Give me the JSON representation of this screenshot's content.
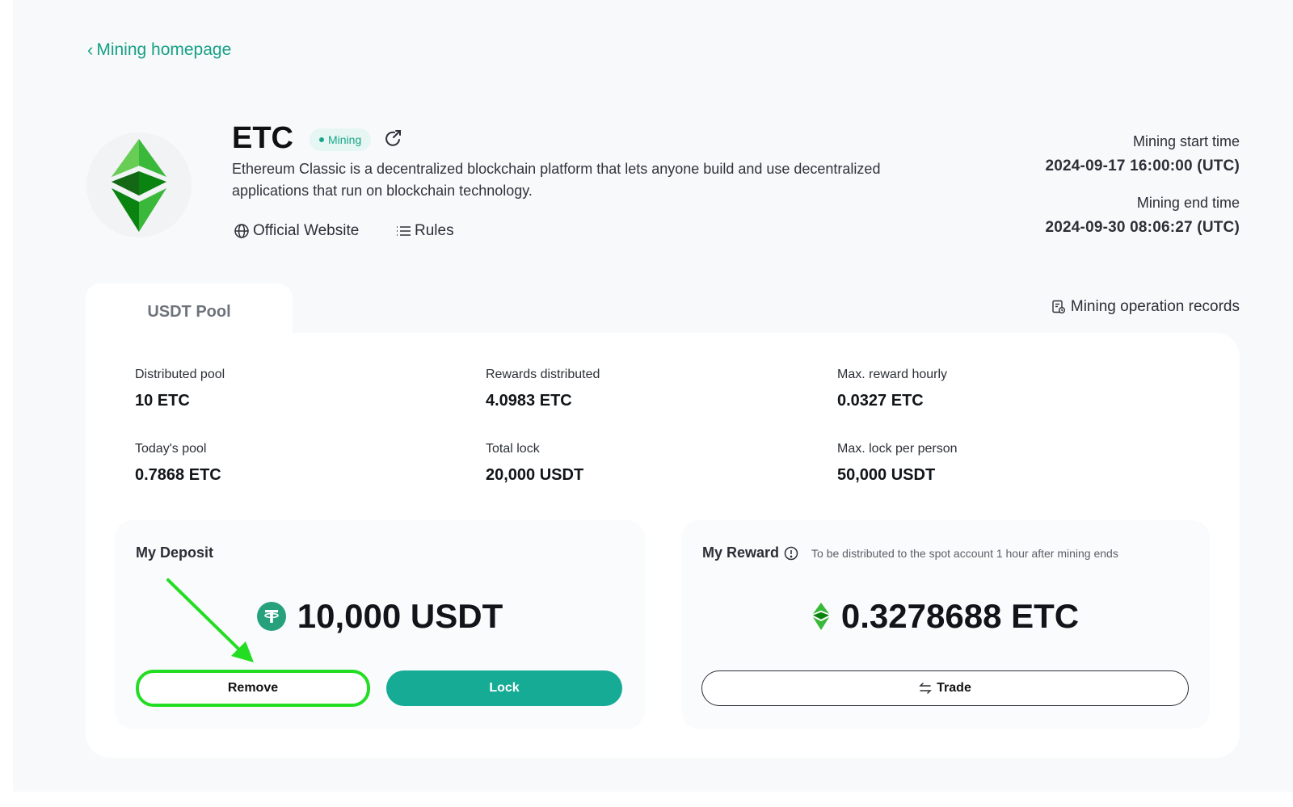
{
  "nav": {
    "back_label": "Mining homepage"
  },
  "coin": {
    "symbol": "ETC",
    "status": "Mining",
    "description": "Ethereum Classic is a decentralized blockchain platform that lets anyone build and use decentralized applications that run on blockchain technology.",
    "links": {
      "official": "Official Website",
      "rules": "Rules"
    },
    "icon": "etc-logo-icon"
  },
  "schedule": {
    "start_label": "Mining start time",
    "start_value": "2024-09-17 16:00:00 (UTC)",
    "end_label": "Mining end time",
    "end_value": "2024-09-30 08:06:27 (UTC)"
  },
  "pool": {
    "tab_label": "USDT Pool",
    "records_label": "Mining operation records",
    "stats": [
      {
        "label": "Distributed pool",
        "value": "10 ETC"
      },
      {
        "label": "Rewards distributed",
        "value": "4.0983 ETC"
      },
      {
        "label": "Max. reward hourly",
        "value": "0.0327 ETC"
      },
      {
        "label": "Today's pool",
        "value": "0.7868 ETC"
      },
      {
        "label": "Total lock",
        "value": "20,000 USDT"
      },
      {
        "label": "Max. lock per person",
        "value": "50,000 USDT"
      }
    ]
  },
  "deposit": {
    "title": "My Deposit",
    "amount": "10,000 USDT",
    "remove_label": "Remove",
    "lock_label": "Lock"
  },
  "reward": {
    "title": "My Reward",
    "note": "To be distributed to the spot account 1 hour after mining ends",
    "amount": "0.3278688 ETC",
    "trade_label": "Trade"
  },
  "colors": {
    "accent": "#15ab95",
    "link": "#16a085",
    "highlight": "#22dd22",
    "etc_green": "#3ab83a",
    "tether": "#26a17b"
  }
}
